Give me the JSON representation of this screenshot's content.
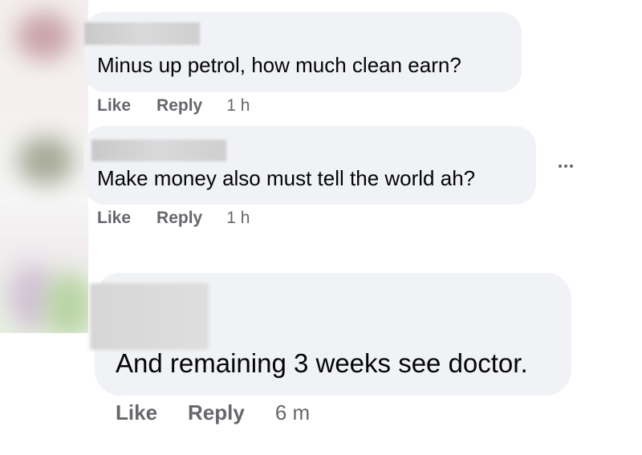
{
  "comments": [
    {
      "text": "Minus up petrol, how much clean earn?",
      "like_label": "Like",
      "reply_label": "Reply",
      "time": "1 h"
    },
    {
      "text": "Make money also must tell the world ah?",
      "like_label": "Like",
      "reply_label": "Reply",
      "time": "1 h"
    },
    {
      "text": "And remaining 3 weeks see doctor.",
      "like_label": "Like",
      "reply_label": "Reply",
      "time": "6 m"
    }
  ],
  "more_options_icon": "more-horizontal-icon"
}
